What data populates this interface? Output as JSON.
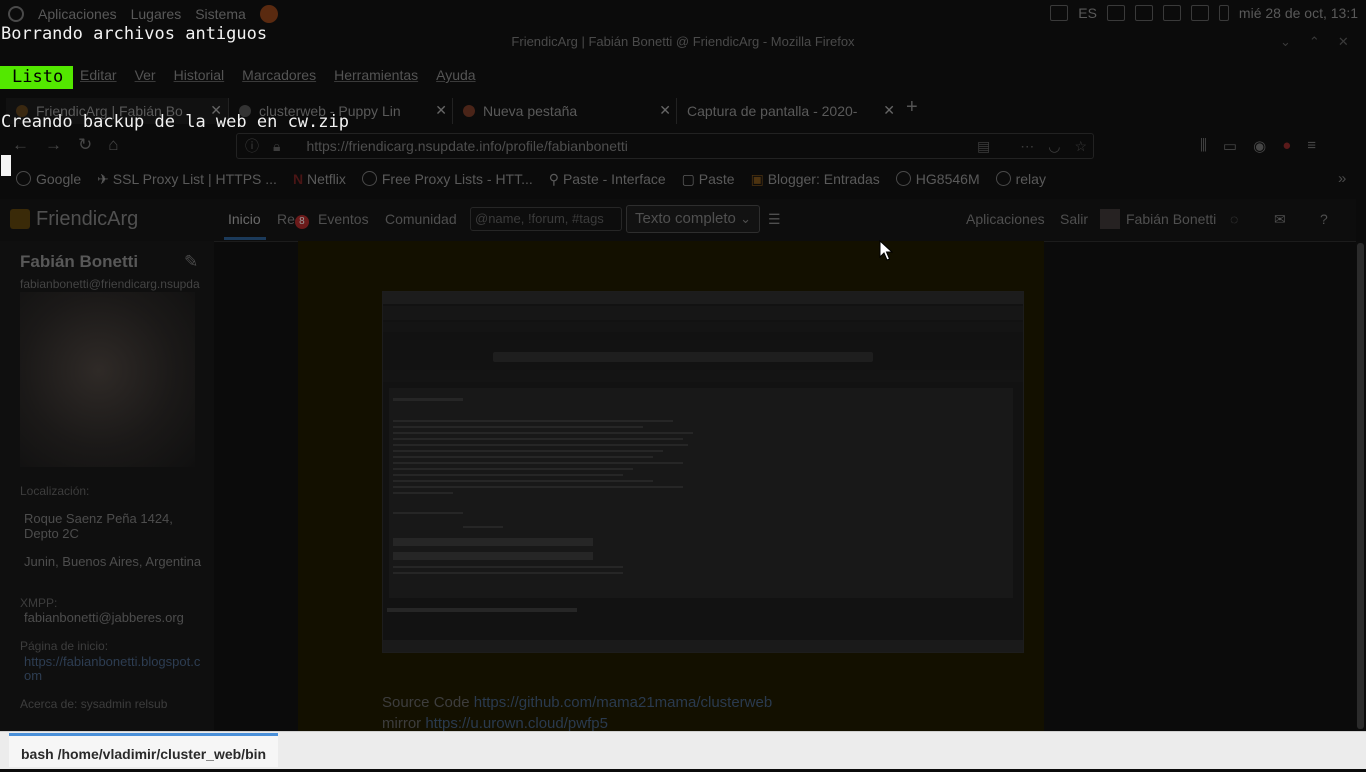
{
  "os_panel": {
    "menus": [
      "Aplicaciones",
      "Lugares",
      "Sistema"
    ],
    "keyboard_layout": "ES",
    "datetime": "mié 28 de oct, 13:1"
  },
  "firefox": {
    "title": "FriendicArg | Fabián Bonetti @ FriendicArg - Mozilla Firefox",
    "menu": [
      "Editar",
      "Ver",
      "Historial",
      "Marcadores",
      "Herramientas",
      "Ayuda"
    ],
    "tabs": [
      {
        "label": "FriendicArg | Fabián Bo"
      },
      {
        "label": "clusterweb - Puppy Lin"
      },
      {
        "label": "Nueva pestaña"
      },
      {
        "label": "Captura de pantalla - 2020-"
      }
    ],
    "url": "https://friendicarg.nsupdate.info/profile/fabianbonetti",
    "bookmarks": [
      "Google",
      "SSL Proxy List | HTTPS ...",
      "Netflix",
      "Free Proxy Lists - HTT...",
      "Paste - Interface",
      "Paste",
      "Blogger: Entradas",
      "HG8546M",
      "relay"
    ]
  },
  "site": {
    "brand": "FriendicArg",
    "nav": {
      "inicio": "Inicio",
      "red_prefix": "Re",
      "red_badge": "8",
      "eventos": "Eventos",
      "comunidad": "Comunidad",
      "search_placeholder": "@name, !forum, #tags",
      "search_mode": "Texto completo",
      "aplicaciones": "Aplicaciones",
      "salir": "Salir",
      "user": "Fabián Bonetti"
    },
    "profile": {
      "name": "Fabián Bonetti",
      "address": "fabianbonetti@friendicarg.nsupda",
      "location_label": "Localización:",
      "street": "Roque Saenz Peña 1424,",
      "depto": "Depto 2C",
      "city": "Junin, Buenos Aires, Argentina",
      "xmpp_label": "XMPP:",
      "xmpp": "fabianbonetti@jabberes.org",
      "homepage_label": "Página de inicio:",
      "homepage_1": "https://fabianbonetti.blogspot.c",
      "homepage_2": "om",
      "about": "Acerca de: sysadmin relsub"
    },
    "post": {
      "line1_prefix": "Source Code ",
      "line1_link": "https://github.com/mama21mama/clusterweb",
      "line2_prefix": "mirror ",
      "line2_link": "https://u.urown.cloud/pwfp5"
    }
  },
  "terminal": {
    "line1": "Borrando archivos antiguos",
    "status": "Listo",
    "line2": "Creando backup de la web en cw.zip"
  },
  "taskbar": {
    "task": "bash /home/vladimir/cluster_web/bin"
  },
  "colors": {
    "status_green": "#53e800",
    "terminal_text": "#f2f2f2",
    "taskbar_bg": "#ececec"
  }
}
